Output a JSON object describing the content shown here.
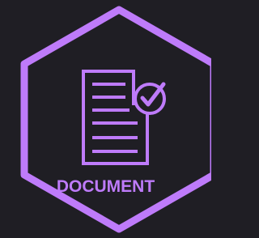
{
  "badge": {
    "label": "DOCUMENT",
    "icon": "document-checkmark-icon",
    "shape": "hexagon",
    "colors": {
      "background": "#1f1e24",
      "accent": "#be7bfa"
    }
  }
}
